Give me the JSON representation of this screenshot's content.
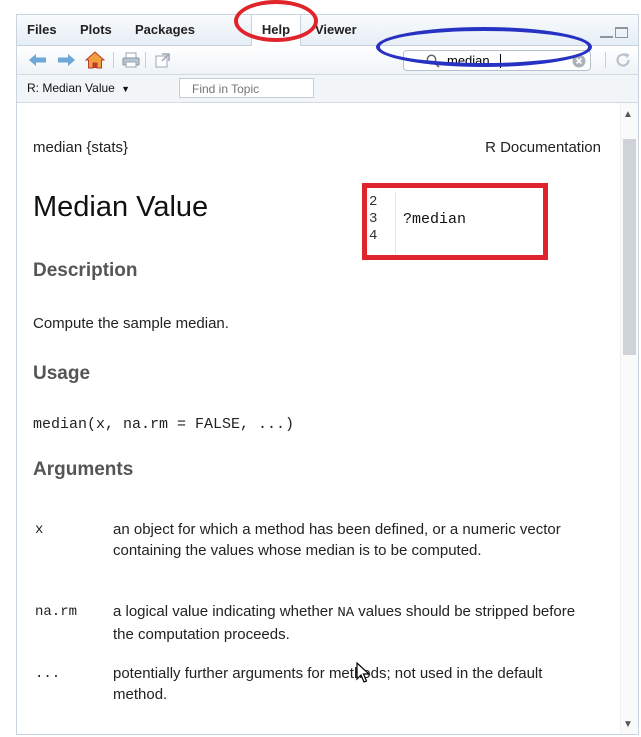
{
  "tabs": [
    {
      "label": "Files"
    },
    {
      "label": "Plots"
    },
    {
      "label": "Packages"
    },
    {
      "label": "Help"
    },
    {
      "label": "Viewer"
    }
  ],
  "active_tab": "Help",
  "toolbar": {
    "search_value": "median",
    "icons": [
      "back-arrow-icon",
      "forward-arrow-icon",
      "home-icon",
      "print-icon",
      "popout-icon",
      "search-icon",
      "clear-search-icon",
      "refresh-icon"
    ]
  },
  "topic": {
    "select_label": "R: Median Value",
    "find_placeholder": "Find in Topic"
  },
  "doc": {
    "header_left": "median {stats}",
    "header_right": "R Documentation",
    "title": "Median Value",
    "description_heading": "Description",
    "description_text": "Compute the sample median.",
    "usage_heading": "Usage",
    "usage_code": "median(x, na.rm = FALSE, ...)",
    "arguments_heading": "Arguments",
    "arguments": [
      {
        "name": "x",
        "desc": "an object for which a method has been defined, or a numeric vector containing the values whose median is to be computed."
      },
      {
        "name": "na.rm",
        "desc_pre": "a logical value indicating whether ",
        "desc_code": "NA",
        "desc_post": " values should be stripped before the computation proceeds."
      },
      {
        "name": "...",
        "desc": "potentially further arguments for methods; not used in the default method."
      }
    ]
  },
  "code_snippet": {
    "line_numbers": [
      "2",
      "3",
      "4"
    ],
    "code": "?median"
  },
  "colors": {
    "annotation_red": "#e0242b",
    "annotation_blue": "#2832c2",
    "heading_gray": "#555555"
  }
}
